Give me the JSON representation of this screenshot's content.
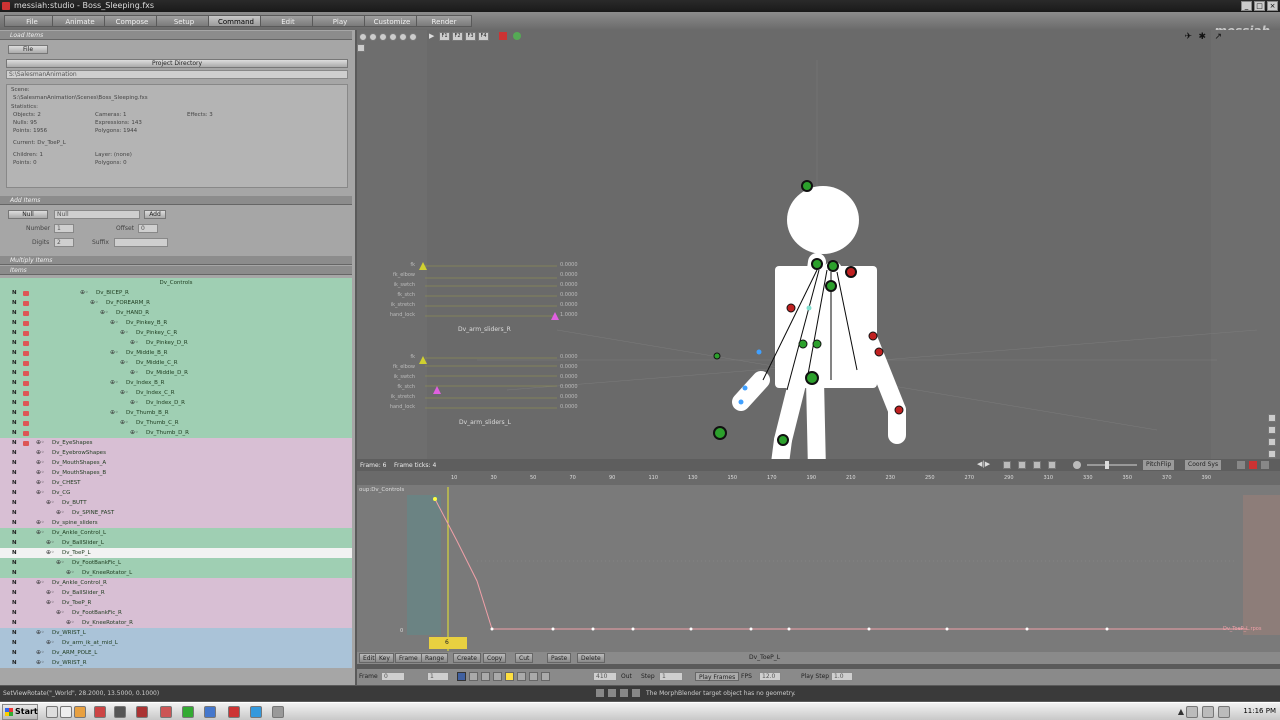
{
  "window": {
    "title": "messiah:studio - Boss_Sleeping.fxs",
    "controls": [
      "_",
      "□",
      "×"
    ]
  },
  "menu": {
    "items": [
      "File",
      "Animate",
      "Compose",
      "Setup",
      "Command",
      "Edit",
      "Play",
      "Customize",
      "Render"
    ],
    "active_index": 4,
    "logo": "messiah"
  },
  "load_items": {
    "header": "Load Items",
    "file_button": "File",
    "project_dir_button": "Project Directory",
    "path": "S:\\SalesmanAnimation",
    "info": {
      "scene_label": "Scene:",
      "scene_path": "S:\\SalesmanAnimation\\Scenes\\Boss_Sleeping.fxs",
      "statistics_label": "Statistics:",
      "objects": "Objects: 2",
      "nulls": "Nulls: 95",
      "points": "Points: 1956",
      "cameras": "Cameras: 1",
      "expressions": "Expressions: 143",
      "polygons": "Polygons: 1944",
      "effects": "Effects: 3",
      "current": "Current: Dv_ToeP_L",
      "children": "Children: 1",
      "points2": "Points: 0",
      "layer": "Layer: (none)",
      "polygons2": "Polygons: 0"
    }
  },
  "add_items": {
    "header": "Add Items",
    "type_button": "Null",
    "type_field": "Null",
    "add_button": "Add",
    "number_label": "Number",
    "number_value": "1",
    "offset_label": "Offset",
    "offset_value": "0",
    "digits_label": "Digits",
    "digits_value": "2",
    "suffix_label": "Suffix"
  },
  "multiply_items": {
    "header": "Multiply Items",
    "next_header": "Items"
  },
  "tree": {
    "title": "Dv_Controls",
    "rows": [
      {
        "label": "Dv_BICEP_R",
        "indent": 0
      },
      {
        "label": "Dv_FOREARM_R",
        "indent": 1
      },
      {
        "label": "Dv_HAND_R",
        "indent": 2
      },
      {
        "label": "Dv_Pinkey_B_R",
        "indent": 3
      },
      {
        "label": "Dv_Pinkey_C_R",
        "indent": 4
      },
      {
        "label": "Dv_Pinkey_D_R",
        "indent": 5
      },
      {
        "label": "Dv_Middle_B_R",
        "indent": 3
      },
      {
        "label": "Dv_Middle_C_R",
        "indent": 4
      },
      {
        "label": "Dv_Middle_D_R",
        "indent": 5
      },
      {
        "label": "Dv_Index_B_R",
        "indent": 3
      },
      {
        "label": "Dv_Index_C_R",
        "indent": 4
      },
      {
        "label": "Dv_Index_D_R",
        "indent": 5
      },
      {
        "label": "Dv_Thumb_B_R",
        "indent": 3
      },
      {
        "label": "Dv_Thumb_C_R",
        "indent": 4
      },
      {
        "label": "Dv_Thumb_D_R",
        "indent": 5
      },
      {
        "label": "Dv_EyeShapes",
        "indent": 0
      },
      {
        "label": "Dv_EyebrowShapes",
        "indent": 0
      },
      {
        "label": "Dv_MouthShapes_A",
        "indent": 0
      },
      {
        "label": "Dv_MouthShapes_B",
        "indent": 0
      },
      {
        "label": "Dv_CHEST",
        "indent": 0
      },
      {
        "label": "Dv_CG",
        "indent": 0
      },
      {
        "label": "Dv_BUTT",
        "indent": 1
      },
      {
        "label": "Dv_SPINE_FAST",
        "indent": 2
      },
      {
        "label": "Dv_spine_sliders",
        "indent": 0
      },
      {
        "label": "Dv_Ankle_Control_L",
        "indent": 0
      },
      {
        "label": "Dv_BallSlider_L",
        "indent": 1
      },
      {
        "label": "Dv_ToeP_L",
        "indent": 1
      },
      {
        "label": "Dv_FootBankFic_L",
        "indent": 2
      },
      {
        "label": "Dv_KneeRotator_L",
        "indent": 3
      },
      {
        "label": "Dv_Ankle_Control_R",
        "indent": 0
      },
      {
        "label": "Dv_BallSlider_R",
        "indent": 1
      },
      {
        "label": "Dv_ToeP_R",
        "indent": 1
      },
      {
        "label": "Dv_FootBankFic_R",
        "indent": 2
      },
      {
        "label": "Dv_KneeRotator_R",
        "indent": 3
      },
      {
        "label": "Dv_WRIST_L",
        "indent": 0
      },
      {
        "label": "Dv_arm_ik_at_mid_L",
        "indent": 1
      },
      {
        "label": "Dv_ARM_POLE_L",
        "indent": 0
      },
      {
        "label": "Dv_WRIST_R",
        "indent": 0
      }
    ]
  },
  "viewport": {
    "frame_buttons": [
      "F1",
      "F2",
      "F3",
      "F4"
    ],
    "arm_slider_groups": [
      {
        "title": "Dv_arm_sliders_R",
        "value": "0.0000",
        "last_value": "1.0000"
      },
      {
        "title": "Dv_arm_sliders_L",
        "value": "0.0000",
        "last_value": "0.0000"
      }
    ],
    "status_frame": "Frame: 6",
    "status_ticks": "Frame ticks: 4",
    "pitch_flip": "PitchFlip",
    "coord_sys": "Coord Sys"
  },
  "timeline": {
    "track_label": "oup:Dv_Controls",
    "ticks": [
      "10",
      "30",
      "50",
      "70",
      "90",
      "110",
      "130",
      "150",
      "170",
      "190",
      "210",
      "230",
      "250",
      "270",
      "290",
      "310",
      "330",
      "350",
      "370",
      "390"
    ],
    "current_frame": "6",
    "zero_label": "0",
    "curve_label": "Dv_ToeP_L.rpos"
  },
  "bottom_toolbar": {
    "buttons": [
      "Edit",
      "Key",
      "Frame",
      "Range",
      "Create",
      "Copy",
      "Cut",
      "Paste",
      "Delete"
    ],
    "item_name": "Dv_ToeP_L"
  },
  "play_toolbar": {
    "frame_label": "Frame",
    "frame_value": "0",
    "in_value": "1",
    "out_value": "410",
    "out_label": "Out",
    "step_label": "Step",
    "step_value": "1",
    "play_frames": "Play Frames",
    "fps_label": "FPS",
    "fps_value": "12.0",
    "play_step_label": "Play Step",
    "play_step_value": "1.0"
  },
  "status": {
    "command": "SetViewRotate(\"_World\", 28.2000, 13.5000, 0.1000)",
    "message": "The MorphBlender target object has no geometry."
  },
  "taskbar": {
    "start_label": "Start",
    "clock": "11:16 PM"
  },
  "colors": {
    "tree_green": "#9fcfb3",
    "tree_pink": "#d8bfd4",
    "tree_blue": "#aac3d8",
    "curve": "#f0a0a8",
    "accent_yellow": "#ffff40"
  }
}
